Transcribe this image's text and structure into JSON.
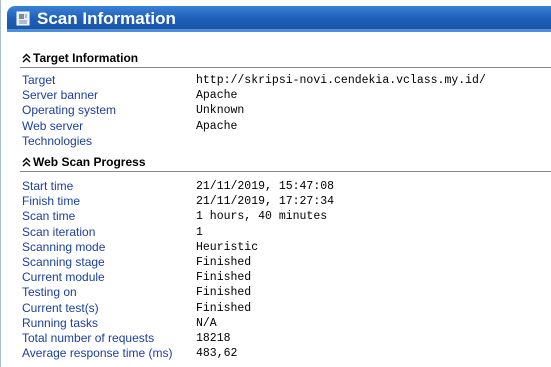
{
  "header": {
    "title": "Scan Information",
    "icon": "scan-info-icon"
  },
  "target_section": {
    "heading": "Target Information",
    "rows": [
      {
        "label": "Target",
        "value": "http://skripsi-novi.cendekia.vclass.my.id/"
      },
      {
        "label": "Server banner",
        "value": "Apache"
      },
      {
        "label": "Operating system",
        "value": "Unknown"
      },
      {
        "label": "Web server",
        "value": "Apache"
      },
      {
        "label": "Technologies",
        "value": ""
      }
    ]
  },
  "progress_section": {
    "heading": "Web Scan Progress",
    "rows": [
      {
        "label": "Start time",
        "value": "21/11/2019, 15:47:08"
      },
      {
        "label": "Finish time",
        "value": "21/11/2019, 17:27:34"
      },
      {
        "label": "Scan time",
        "value": "1 hours, 40 minutes"
      },
      {
        "label": "Scan iteration",
        "value": "1"
      },
      {
        "label": "Scanning mode",
        "value": "Heuristic"
      },
      {
        "label": "Scanning stage",
        "value": "Finished"
      },
      {
        "label": "Current module",
        "value": "Finished"
      },
      {
        "label": "Testing on",
        "value": "Finished"
      },
      {
        "label": "Current test(s)",
        "value": "Finished"
      },
      {
        "label": "Running tasks",
        "value": "N/A"
      },
      {
        "label": "Total number of requests",
        "value": "18218"
      },
      {
        "label": "Average response time (ms)",
        "value": "483,62"
      }
    ]
  },
  "colors": {
    "title_bar": "#1f5fb8",
    "label_text": "#1a3f9e",
    "value_text": "#000000"
  }
}
